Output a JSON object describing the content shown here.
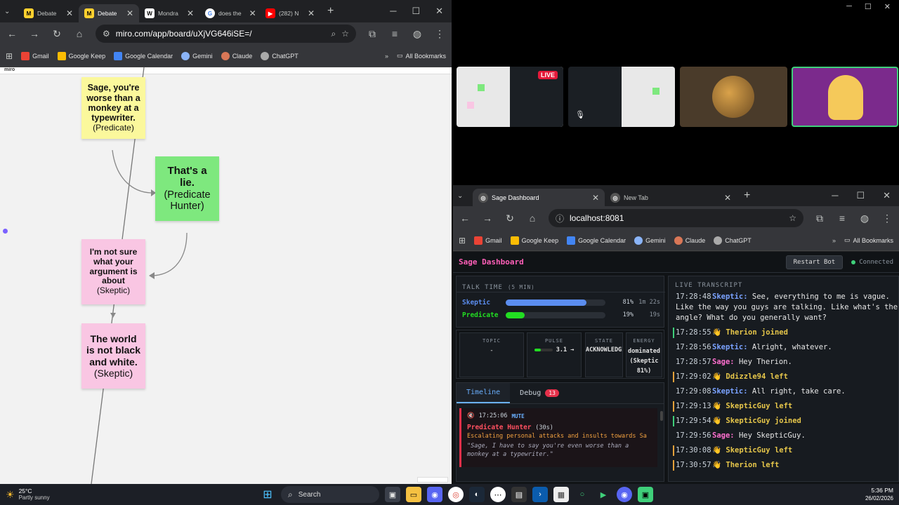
{
  "left_browser": {
    "tabs": [
      {
        "label": "Debate",
        "icon": "miro-icon"
      },
      {
        "label": "Debate",
        "icon": "miro-icon"
      },
      {
        "label": "Mondra",
        "icon": "wikipedia-icon"
      },
      {
        "label": "does the",
        "icon": "google-icon"
      },
      {
        "label": "(282) N",
        "icon": "youtube-icon"
      }
    ],
    "url": "miro.com/app/board/uXjVG646iSE=/",
    "bookmarks": [
      "Gmail",
      "Google Keep",
      "Google Calendar",
      "Gemini",
      "Claude",
      "ChatGPT"
    ],
    "all_bookmarks": "All Bookmarks"
  },
  "miro": {
    "logo": "miro",
    "stickies": [
      {
        "main": "Sage, you're worse than a monkey at a typewriter.",
        "sub": "(Predicate)",
        "color": "#fbf89c"
      },
      {
        "main": "That's a lie.",
        "sub": "(Predicate Hunter)",
        "color": "#7ee87e"
      },
      {
        "main": "I'm not sure what your argument is about",
        "sub": "(Skeptic)",
        "color": "#f9c6e3"
      },
      {
        "main": "The world is not black and white.",
        "sub": "(Skeptic)",
        "color": "#f9c6e3"
      }
    ]
  },
  "video": {
    "live_badge": "LIVE"
  },
  "right_browser": {
    "tabs": [
      {
        "label": "Sage Dashboard"
      },
      {
        "label": "New Tab"
      }
    ],
    "url": "localhost:8081",
    "bookmarks": [
      "Gmail",
      "Google Keep",
      "Google Calendar",
      "Gemini",
      "Claude",
      "ChatGPT"
    ],
    "all_bookmarks": "All Bookmarks"
  },
  "dashboard": {
    "title": "Sage Dashboard",
    "restart_label": "Restart Bot",
    "status": "Connected",
    "talk_time": {
      "heading": "TALK TIME",
      "window": "(5 MIN)",
      "rows": [
        {
          "name": "Skeptic",
          "pct": "81%",
          "time": "1m 22s",
          "fraction": 0.81,
          "color": "#5b8def"
        },
        {
          "name": "Predicate",
          "pct": "19%",
          "time": "19s",
          "fraction": 0.19,
          "color": "#22dd22"
        }
      ]
    },
    "stats": {
      "topic_label": "TOPIC",
      "topic_value": "-",
      "pulse_label": "PULSE",
      "pulse_value": "3.1 →",
      "state_label": "STATE",
      "state_value": "ACKNOWLEDGI",
      "energy_label": "ENERGY",
      "energy_value": "dominated (Skeptic 81%)"
    },
    "tabs": {
      "timeline": "Timeline",
      "debug": "Debug",
      "debug_count": "13"
    },
    "timeline_entry": {
      "time": "17:25:06",
      "tag": "MUTE",
      "who": "Predicate Hunter",
      "duration": "(30s)",
      "reason": "Escalating personal attacks and insults towards Sa",
      "quote": "\"Sage, I have to say you're even worse than a monkey at a typewriter.\""
    },
    "transcript": {
      "heading": "LIVE TRANSCRIPT",
      "lines": [
        {
          "time": "17:28:48",
          "speaker": "Skeptic:",
          "kind": "sk",
          "text": "See, everything to me is vague.",
          "cont": [
            "Like the way you guys are talking. Like what's the",
            "angle? What do you generally want?"
          ]
        },
        {
          "time": "17:28:55",
          "speaker": "",
          "kind": "join",
          "text": "Therion joined"
        },
        {
          "time": "17:28:56",
          "speaker": "Skeptic:",
          "kind": "sk",
          "text": "Alright, whatever."
        },
        {
          "time": "17:28:57",
          "speaker": "Sage:",
          "kind": "sg",
          "text": "Hey Therion."
        },
        {
          "time": "17:29:02",
          "speaker": "",
          "kind": "left",
          "text": "Ddizzle94 left"
        },
        {
          "time": "17:29:08",
          "speaker": "Skeptic:",
          "kind": "sk",
          "text": "All right, take care."
        },
        {
          "time": "17:29:13",
          "speaker": "",
          "kind": "left",
          "text": "SkepticGuy left"
        },
        {
          "time": "17:29:54",
          "speaker": "",
          "kind": "join",
          "text": "SkepticGuy joined"
        },
        {
          "time": "17:29:56",
          "speaker": "Sage:",
          "kind": "sg",
          "text": "Hey SkepticGuy."
        },
        {
          "time": "17:30:08",
          "speaker": "",
          "kind": "left",
          "text": "SkepticGuy left"
        },
        {
          "time": "17:30:57",
          "speaker": "",
          "kind": "left",
          "text": "Therion left"
        }
      ]
    }
  },
  "taskbar": {
    "weather_temp": "25°C",
    "weather_desc": "Partly sunny",
    "search": "Search",
    "time": "5:36 PM",
    "date": "26/02/2026"
  }
}
